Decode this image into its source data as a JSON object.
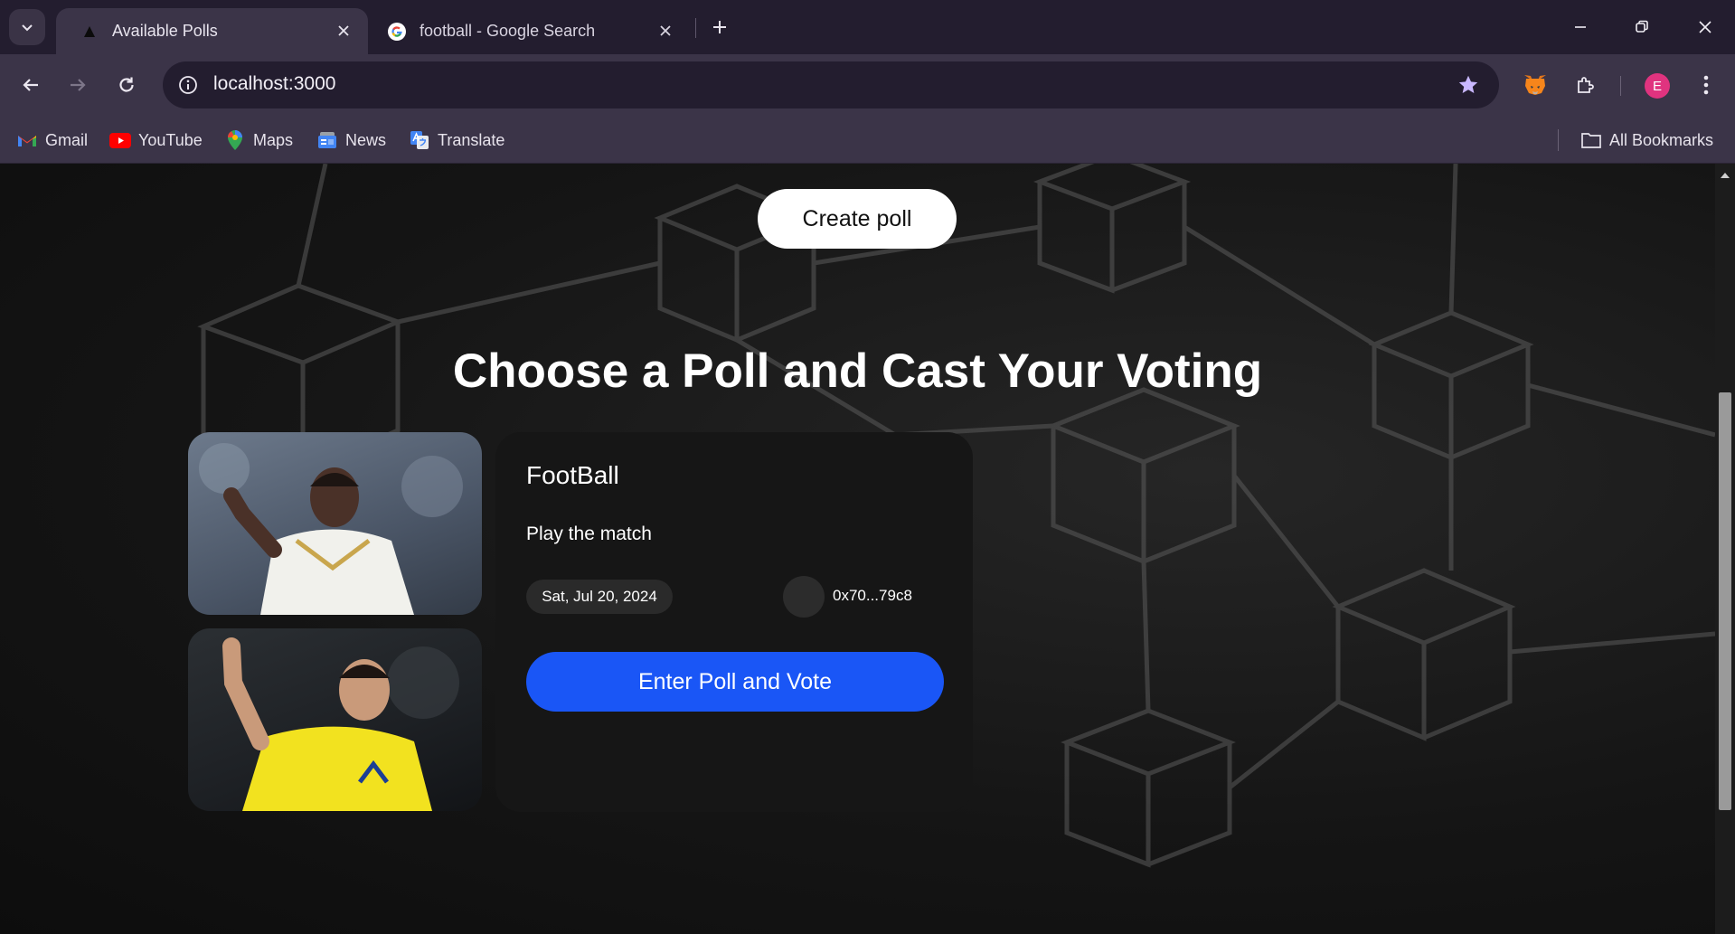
{
  "browser": {
    "tabs": [
      {
        "title": "Available Polls",
        "icon": "triangle-logo-icon",
        "active": true
      },
      {
        "title": "football - Google Search",
        "icon": "google-icon",
        "active": false
      }
    ],
    "url": "localhost:3000",
    "avatar_letter": "E",
    "bookmarks": [
      {
        "label": "Gmail",
        "icon": "gmail-icon"
      },
      {
        "label": "YouTube",
        "icon": "youtube-icon"
      },
      {
        "label": "Maps",
        "icon": "maps-icon"
      },
      {
        "label": "News",
        "icon": "news-icon"
      },
      {
        "label": "Translate",
        "icon": "translate-icon"
      }
    ],
    "all_bookmarks_label": "All Bookmarks"
  },
  "page": {
    "create_button_label": "Create poll",
    "heading": "Choose a Poll and Cast Your Voting",
    "poll": {
      "title": "FootBall",
      "description": "Play the match",
      "date": "Sat, Jul 20, 2024",
      "address": "0x70...79c8",
      "vote_button_label": "Enter Poll and Vote",
      "images": [
        "player-white-jersey-photo",
        "player-yellow-jersey-photo"
      ]
    }
  },
  "colors": {
    "chrome_dark": "#231d2f",
    "chrome": "#3b3448",
    "accent_blue": "#1a56f6",
    "card_bg": "#161616",
    "avatar": "#e0337f"
  }
}
